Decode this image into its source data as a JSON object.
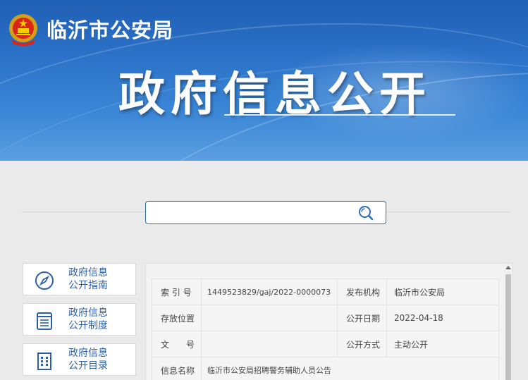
{
  "header": {
    "site_name": "临沂市公安局",
    "banner_title": "政府信息公开"
  },
  "search": {
    "value": "",
    "placeholder": ""
  },
  "sidebar": {
    "items": [
      {
        "line1": "政府信息",
        "line2": "公开指南",
        "icon": "compass-icon"
      },
      {
        "line1": "政府信息",
        "line2": "公开制度",
        "icon": "document-list-icon"
      },
      {
        "line1": "政府信息",
        "line2": "公开目录",
        "icon": "grid-icon"
      }
    ]
  },
  "info_table": {
    "rows": [
      {
        "k1": "索 引 号",
        "v1": "1449523829/gaj/2022-0000073",
        "k2": "发布机构",
        "v2": "临沂市公安局"
      },
      {
        "k1": "存放位置",
        "v1": "",
        "k2": "公开日期",
        "v2": "2022-04-18"
      },
      {
        "k1": "文　　号",
        "v1": "",
        "k2": "公开方式",
        "v2": "主动公开"
      },
      {
        "k1": "信息名称",
        "v1": "临沂市公安局招聘警务辅助人员公告"
      }
    ]
  },
  "colors": {
    "banner_blue": "#2b72c8",
    "accent": "#2e6db4",
    "link_text": "#2d5fa8"
  }
}
